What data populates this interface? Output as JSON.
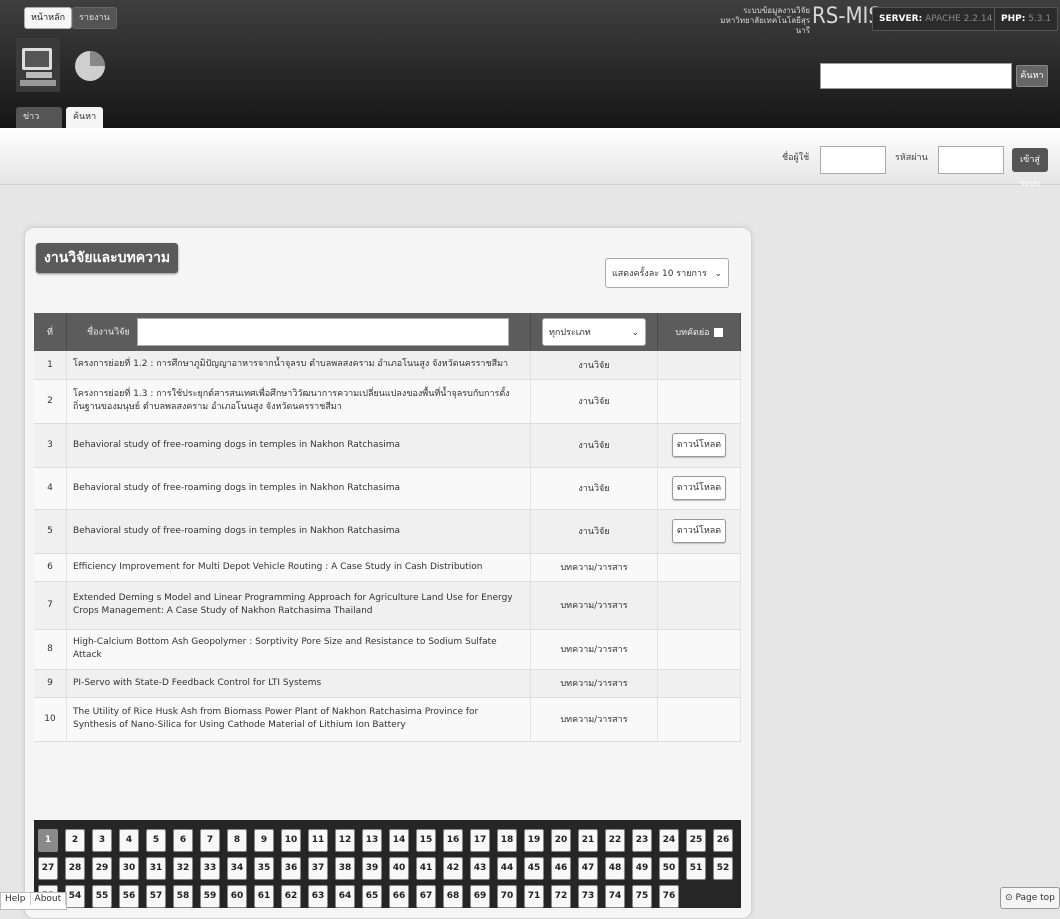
{
  "header": {
    "home_label": "หน้าหลัก",
    "report_label": "รายงาน",
    "brand_line1": "ระบบข้อมูลงานวิจัย",
    "brand_line2": "มหาวิทยาลัยเทคโนโลยีสุรนารี",
    "brand_logo": "RS-MIS",
    "server_label": "SERVER:",
    "server_value": "APACHE 2.2.14",
    "php_label": "PHP:",
    "php_value": "5.3.1",
    "search_button": "ค้นหา"
  },
  "tabs": [
    "ข่าวประกาศ",
    "ค้นหางานวิจัย"
  ],
  "login": {
    "user_label": "ชื่อผู้ใช้",
    "password_label": "รหัสผ่าน",
    "button": "เข้าสู่ระบบ"
  },
  "panel": {
    "title": "งานวิจัยและบทความ",
    "per_page": "แสดงครั้งละ 10 รายการ"
  },
  "table": {
    "col_no": "ที่",
    "col_title": "ชื่องานวิจัย",
    "type_filter": "ทุกประเภท",
    "col_abstract": "บทคัดย่อ",
    "rows": [
      {
        "no": "1",
        "title": "โครงการย่อยที่ 1.2 : การศึกษาภูมิปัญญาอาหารจากน้ำจุลรบ ตำบลพลสงคราม อำเภอโนนสูง จังหวัดนครราชสีมา",
        "type": "งานวิจัย",
        "download": ""
      },
      {
        "no": "2",
        "title": "โครงการย่อยที่ 1.3 : การใช้ประยุกต์สารสนเทศเพื่อศึกษาวิวัฒนาการความเปลี่ยนแปลงของพื้นที่น้ำจุลรบกับการตั้งถิ่นฐานของมนุษย์ ตำบลพลสงคราม อำเภอโนนสูง จังหวัดนครราชสีมา",
        "type": "งานวิจัย",
        "download": ""
      },
      {
        "no": "3",
        "title": "Behavioral study of free-roaming dogs in temples in Nakhon Ratchasima",
        "type": "งานวิจัย",
        "download": "ดาวน์โหลด"
      },
      {
        "no": "4",
        "title": "Behavioral study of free-roaming dogs in temples in Nakhon Ratchasima",
        "type": "งานวิจัย",
        "download": "ดาวน์โหลด"
      },
      {
        "no": "5",
        "title": "Behavioral study of free-roaming dogs in temples in Nakhon Ratchasima",
        "type": "งานวิจัย",
        "download": "ดาวน์โหลด"
      },
      {
        "no": "6",
        "title": "Efficiency Improvement for Multi Depot Vehicle Routing : A Case Study in Cash Distribution",
        "type": "บทความ/วารสาร",
        "download": ""
      },
      {
        "no": "7",
        "title": "Extended Deming s Model and Linear Programming Approach for Agriculture Land Use for Energy Crops Management: A Case Study of Nakhon Ratchasima Thailand",
        "type": "บทความ/วารสาร",
        "download": ""
      },
      {
        "no": "8",
        "title": "High-Calcium Bottom Ash Geopolymer : Sorptivity Pore Size and Resistance to Sodium Sulfate Attack",
        "type": "บทความ/วารสาร",
        "download": ""
      },
      {
        "no": "9",
        "title": "PI-Servo with State-D Feedback Control for LTI Systems",
        "type": "บทความ/วารสาร",
        "download": ""
      },
      {
        "no": "10",
        "title": "The Utility of Rice Husk Ash from Biomass Power Plant of Nakhon Ratchasima Province for Synthesis of Nano-Silica for Using Cathode Material of Lithium Ion Battery",
        "type": "บทความ/วารสาร",
        "download": ""
      }
    ]
  },
  "pagination": {
    "current": "1",
    "pages": [
      "1",
      "2",
      "3",
      "4",
      "5",
      "6",
      "7",
      "8",
      "9",
      "10",
      "11",
      "12",
      "13",
      "14",
      "15",
      "16",
      "17",
      "18",
      "19",
      "20",
      "21",
      "22",
      "23",
      "24",
      "25",
      "26",
      "27",
      "28",
      "29",
      "30",
      "31",
      "32",
      "33",
      "34",
      "35",
      "36",
      "37",
      "38",
      "39",
      "40",
      "41",
      "42",
      "43",
      "44",
      "45",
      "46",
      "47",
      "48",
      "49",
      "50",
      "51",
      "52",
      "53",
      "54",
      "55",
      "56",
      "57",
      "58",
      "59",
      "60",
      "61",
      "62",
      "63",
      "64",
      "65",
      "66",
      "67",
      "68",
      "69",
      "70",
      "71",
      "72",
      "73",
      "74",
      "75",
      "76"
    ]
  },
  "footer": {
    "help": "Help",
    "about": "About",
    "page_top": "Page top"
  }
}
